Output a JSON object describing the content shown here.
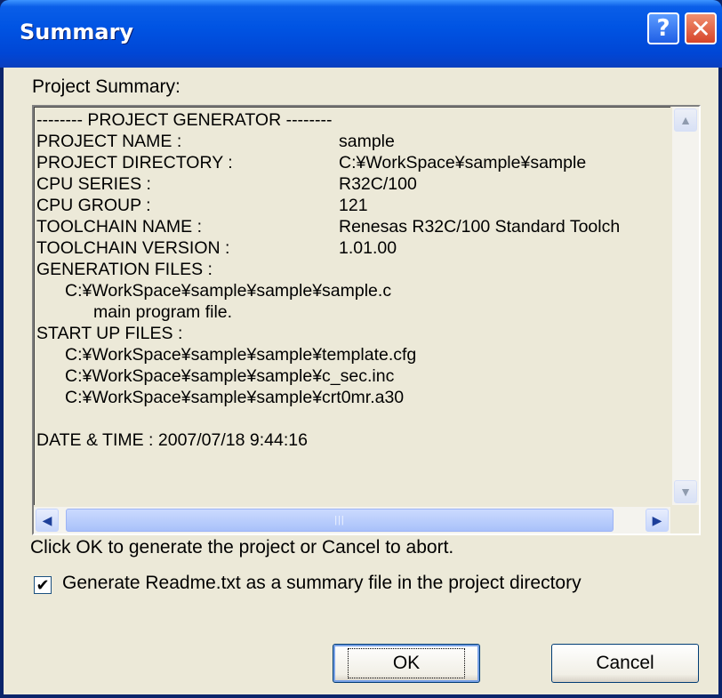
{
  "window": {
    "title": "Summary",
    "help_glyph": "?",
    "close_glyph": "✕"
  },
  "summary": {
    "label": "Project Summary:",
    "lines": [
      {
        "text": "-------- PROJECT GENERATOR --------",
        "value": ""
      },
      {
        "text": "PROJECT NAME :",
        "value": "sample"
      },
      {
        "text": "PROJECT DIRECTORY :",
        "value": "C:¥WorkSpace¥sample¥sample"
      },
      {
        "text": "CPU SERIES :",
        "value": "R32C/100"
      },
      {
        "text": "CPU GROUP :",
        "value": "121"
      },
      {
        "text": "TOOLCHAIN NAME :",
        "value": "Renesas R32C/100 Standard Toolch"
      },
      {
        "text": "TOOLCHAIN VERSION :",
        "value": "1.01.00"
      },
      {
        "text": "GENERATION FILES :",
        "value": ""
      },
      {
        "text": "C:¥WorkSpace¥sample¥sample¥sample.c",
        "value": ""
      },
      {
        "text": "main program file.",
        "value": ""
      },
      {
        "text": "START UP FILES :",
        "value": ""
      },
      {
        "text": "C:¥WorkSpace¥sample¥sample¥template.cfg",
        "value": ""
      },
      {
        "text": "C:¥WorkSpace¥sample¥sample¥c_sec.inc",
        "value": ""
      },
      {
        "text": "C:¥WorkSpace¥sample¥sample¥crt0mr.a30",
        "value": ""
      },
      {
        "text": "",
        "value": ""
      },
      {
        "text": "DATE & TIME : 2007/07/18 9:44:16",
        "value": ""
      }
    ]
  },
  "scroll": {
    "up": "▲",
    "down": "▼",
    "left": "◀",
    "right": "▶",
    "grip": "|||"
  },
  "instruction": "Click OK to generate the project or Cancel to abort.",
  "readme_checkbox": {
    "checked": true,
    "mark": "✔",
    "label": "Generate Readme.txt as a summary file in the project directory"
  },
  "buttons": {
    "ok": "OK",
    "cancel": "Cancel"
  }
}
